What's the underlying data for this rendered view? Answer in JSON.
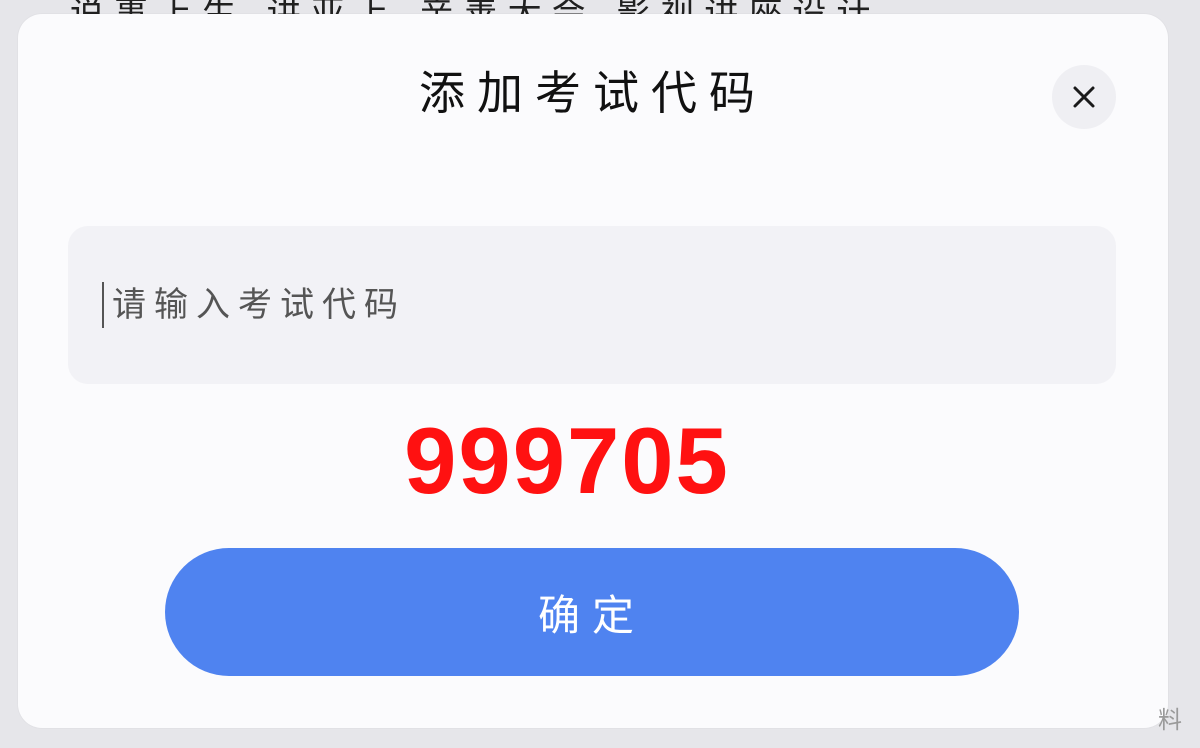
{
  "background": {
    "partial_text": "说事上生 讲亚上 亲善大会 影视讲座设计"
  },
  "dialog": {
    "title": "添加考试代码",
    "close_icon": "close-icon",
    "input": {
      "placeholder": "请输入考试代码",
      "value": ""
    },
    "annotation": {
      "code": "999705",
      "color": "#ff1111"
    },
    "confirm_button": {
      "label": "确定",
      "color": "#4f83f0"
    }
  },
  "corner_mark": "料"
}
